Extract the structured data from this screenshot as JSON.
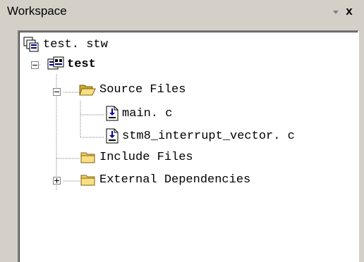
{
  "window": {
    "title": "Workspace",
    "close_glyph": "x",
    "dropdown_glyph": "▼"
  },
  "tree": {
    "workspace_file": {
      "label": "test. stw",
      "icon": "workspace-icon"
    },
    "project": {
      "label": "test",
      "icon": "project-icon",
      "expanded": true
    },
    "source_folder": {
      "label": "Source Files",
      "icon": "open-folder-icon",
      "expanded": true
    },
    "source_files": [
      {
        "label": "main. c",
        "icon": "source-file-icon"
      },
      {
        "label": "stm8_interrupt_vector. c",
        "icon": "source-file-icon"
      }
    ],
    "include_folder": {
      "label": "Include Files",
      "icon": "folder-icon",
      "expanded": false
    },
    "external_folder": {
      "label": "External Dependencies",
      "icon": "folder-icon",
      "expanded": false
    }
  },
  "colors": {
    "panel": "#d4d0c8",
    "tree_background": "#ffffff",
    "folder": "#f0d060",
    "file_arrow": "#0000a0"
  }
}
